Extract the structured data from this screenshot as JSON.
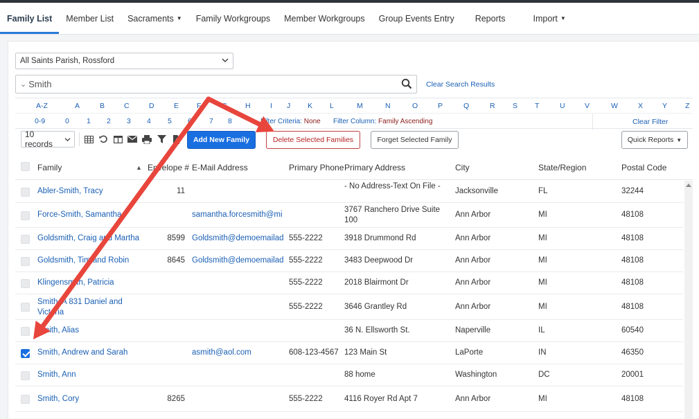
{
  "nav": {
    "items": [
      {
        "label": "Family List",
        "active": true,
        "dropdown": false
      },
      {
        "label": "Member List",
        "dropdown": false
      },
      {
        "label": "Sacraments",
        "dropdown": true
      },
      {
        "label": "Family Workgroups",
        "dropdown": false
      },
      {
        "label": "Member Workgroups",
        "dropdown": false
      },
      {
        "label": "Group Events Entry",
        "dropdown": false
      },
      {
        "label": "Reports",
        "dropdown": false
      },
      {
        "label": "Import",
        "dropdown": true
      }
    ]
  },
  "parish": {
    "selected": "All Saints Parish, Rossford"
  },
  "search": {
    "value": "Smith",
    "clear_label": "Clear Search Results"
  },
  "alpha": {
    "letters": [
      "A-Z",
      "A",
      "B",
      "C",
      "D",
      "E",
      "F",
      "G",
      "H",
      "I",
      "J",
      "K",
      "L",
      "M",
      "N",
      "O",
      "P",
      "Q",
      "R",
      "S",
      "T",
      "U",
      "V",
      "W",
      "X",
      "Y",
      "Z"
    ],
    "digits": [
      "0-9",
      "0",
      "1",
      "2",
      "3",
      "4",
      "5",
      "6",
      "7",
      "8"
    ],
    "filter_criteria_label": "Filter Criteria:",
    "filter_criteria_value": "None",
    "filter_column_label": "Filter Column:",
    "filter_column_value": "Family Ascending",
    "clear_filter": "Clear Filter"
  },
  "toolbar": {
    "records": "10 records",
    "add_new": "Add New Family",
    "delete_selected": "Delete Selected Families",
    "forget_selected": "Forget Selected Family",
    "quick_reports": "Quick Reports"
  },
  "table": {
    "columns": [
      "Family",
      "Envelope #",
      "E-Mail Address",
      "Primary Phone",
      "Primary Address",
      "City",
      "State/Region",
      "Postal Code"
    ],
    "sort_indicator": "▲",
    "rows": [
      {
        "family": "Abler-Smith, Tracy",
        "envelope": "11",
        "email": "",
        "phone": "",
        "address": "- No Address-Text On File -",
        "city": "Jacksonville",
        "state": "FL",
        "postal": "32244",
        "checked": false
      },
      {
        "family": "Force-Smith, Samantha",
        "envelope": "",
        "email": "samantha.forcesmith@mi",
        "phone": "",
        "address": "3767 Ranchero Drive Suite 100",
        "city": "Ann Arbor",
        "state": "MI",
        "postal": "48108",
        "checked": false
      },
      {
        "family": "Goldsmith, Craig and Martha",
        "envelope": "8599",
        "email": "Goldsmith@demoemailad",
        "phone": "555-2222",
        "address": "3918 Drummond Rd",
        "city": "Ann Arbor",
        "state": "MI",
        "postal": "48108",
        "checked": false
      },
      {
        "family": "Goldsmith, Tim and Robin",
        "envelope": "8645",
        "email": "Goldsmith@demoemailad",
        "phone": "555-2222",
        "address": "3483 Deepwood Dr",
        "city": "Ann Arbor",
        "state": "MI",
        "postal": "48108",
        "checked": false
      },
      {
        "family": "Klingensmith, Patricia",
        "envelope": "",
        "email": "",
        "phone": "555-2222",
        "address": "2018 Blairmont Dr",
        "city": "Ann Arbor",
        "state": "MI",
        "postal": "48108",
        "checked": false
      },
      {
        "family": "Smith, A 831 Daniel and Victoria",
        "envelope": "",
        "email": "",
        "phone": "555-2222",
        "address": "3646 Grantley Rd",
        "city": "Ann Arbor",
        "state": "MI",
        "postal": "48108",
        "checked": false
      },
      {
        "family": "Smith, Alias",
        "envelope": "",
        "email": "",
        "phone": "",
        "address": "36 N. Ellsworth St.",
        "city": "Naperville",
        "state": "IL",
        "postal": "60540",
        "checked": false
      },
      {
        "family": "Smith, Andrew and Sarah",
        "envelope": "",
        "email": "asmith@aol.com",
        "phone": "608-123-4567",
        "address": "123 Main St",
        "city": "LaPorte",
        "state": "IN",
        "postal": "46350",
        "checked": true
      },
      {
        "family": "Smith, Ann",
        "envelope": "",
        "email": "",
        "phone": "",
        "address": "88 home",
        "city": "Washington",
        "state": "DC",
        "postal": "20001",
        "checked": false
      },
      {
        "family": "Smith, Cory",
        "envelope": "8265",
        "email": "",
        "phone": "555-2222",
        "address": "4116 Royer Rd Apt 7",
        "city": "Ann Arbor",
        "state": "MI",
        "postal": "48108",
        "checked": false
      }
    ]
  },
  "annotation": {
    "arrow_color": "#e8453c"
  }
}
